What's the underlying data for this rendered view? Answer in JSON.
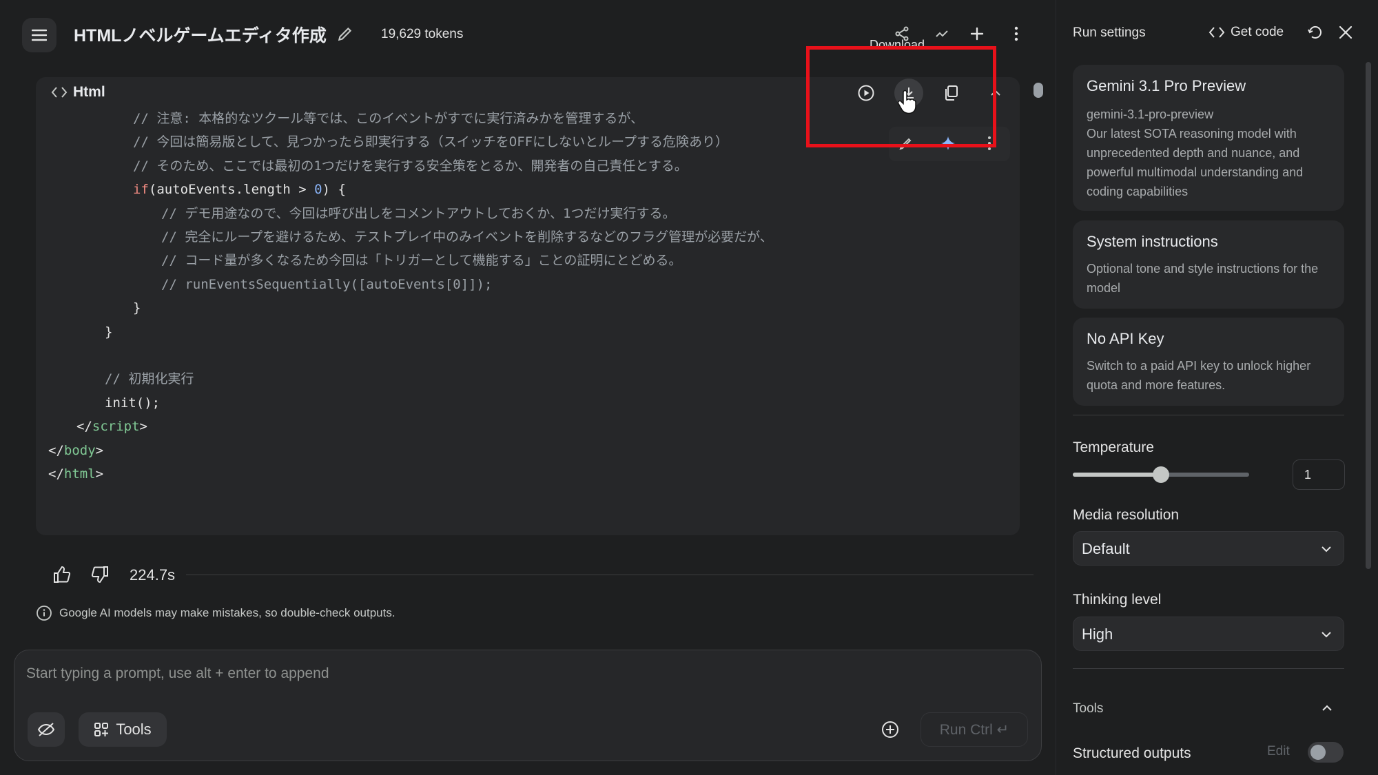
{
  "header": {
    "title": "HTMLノベルゲームエディタ作成",
    "tokens": "19,629 tokens"
  },
  "tooltip": "Download",
  "code_card": {
    "label": "Html",
    "lines": [
      {
        "indent": 0,
        "segments": [
          [
            "cm",
            "// 注意: 本格的なツクール等では、このイベントがすでに実行済みかを管理するが、"
          ]
        ]
      },
      {
        "indent": 0,
        "segments": [
          [
            "cm",
            "// 今回は簡易版として、見つかったら即実行する（スイッチをOFFにしないとループする危険あり）"
          ]
        ]
      },
      {
        "indent": 0,
        "segments": [
          [
            "cm",
            "// そのため、ここでは最初の1つだけを実行する安全策をとるか、開発者の自己責任とする。"
          ]
        ]
      },
      {
        "indent": 0,
        "segments": [
          [
            "kw",
            "if"
          ],
          [
            "",
            "(autoEvents.length > "
          ],
          [
            "num",
            "0"
          ],
          [
            "",
            ") {"
          ]
        ]
      },
      {
        "indent": 1,
        "segments": [
          [
            "cm",
            "// デモ用途なので、今回は呼び出しをコメントアウトしておくか、1つだけ実行する。"
          ]
        ]
      },
      {
        "indent": 1,
        "segments": [
          [
            "cm",
            "// 完全にループを避けるため、テストプレイ中のみイベントを削除するなどのフラグ管理が必要だが、"
          ]
        ]
      },
      {
        "indent": 1,
        "segments": [
          [
            "cm",
            "// コード量が多くなるため今回は「トリガーとして機能する」ことの証明にとどめる。"
          ]
        ]
      },
      {
        "indent": 1,
        "segments": [
          [
            "cm",
            "// runEventsSequentially([autoEvents[0]]);"
          ]
        ]
      },
      {
        "indent": 0,
        "segments": [
          [
            "",
            "}"
          ]
        ]
      },
      {
        "indent": -1,
        "segments": [
          [
            "",
            "}"
          ]
        ]
      },
      {
        "indent": -2,
        "segments": []
      },
      {
        "indent": -1,
        "segments": [
          [
            "cm",
            "// 初期化実行"
          ]
        ]
      },
      {
        "indent": -1,
        "segments": [
          [
            "",
            "init();"
          ]
        ]
      },
      {
        "indent": -2,
        "segments": [
          [
            "",
            "</"
          ],
          [
            "tag",
            "script"
          ],
          [
            "",
            ">"
          ]
        ]
      },
      {
        "indent": -3,
        "segments": [
          [
            "",
            "</"
          ],
          [
            "tag",
            "body"
          ],
          [
            "",
            ">"
          ]
        ]
      },
      {
        "indent": -3,
        "segments": [
          [
            "",
            "</"
          ],
          [
            "tag",
            "html"
          ],
          [
            "",
            ">"
          ]
        ]
      }
    ]
  },
  "feedback": {
    "duration": "224.7s"
  },
  "disclaimer": "Google AI models may make mistakes, so double-check outputs.",
  "prompt": {
    "placeholder": "Start typing a prompt, use alt + enter to append",
    "tools_label": "Tools",
    "run_label": "Run Ctrl ↵"
  },
  "panel": {
    "title": "Run settings",
    "get_code": "Get code",
    "model": {
      "name": "Gemini 3.1 Pro Preview",
      "id": "gemini-3.1-pro-preview",
      "description": "Our latest SOTA reasoning model with unprecedented depth and nuance, and powerful multimodal understanding and coding capabilities"
    },
    "system_instructions": {
      "title": "System instructions",
      "text": "Optional tone and style instructions for the model"
    },
    "api_key": {
      "title": "No API Key",
      "text": "Switch to a paid API key to unlock higher quota and more features."
    },
    "temperature": {
      "label": "Temperature",
      "value": "1",
      "fraction": 0.5
    },
    "media_resolution": {
      "label": "Media resolution",
      "value": "Default"
    },
    "thinking_level": {
      "label": "Thinking level",
      "value": "High"
    },
    "tools": {
      "label": "Tools"
    },
    "structured_outputs": {
      "label": "Structured outputs",
      "edit": "Edit",
      "enabled": false
    }
  },
  "colors": {
    "background": "#1e1f20",
    "card": "#262729",
    "highlight": "#e8111a",
    "accent_sparkle": "#8ab4f8"
  }
}
